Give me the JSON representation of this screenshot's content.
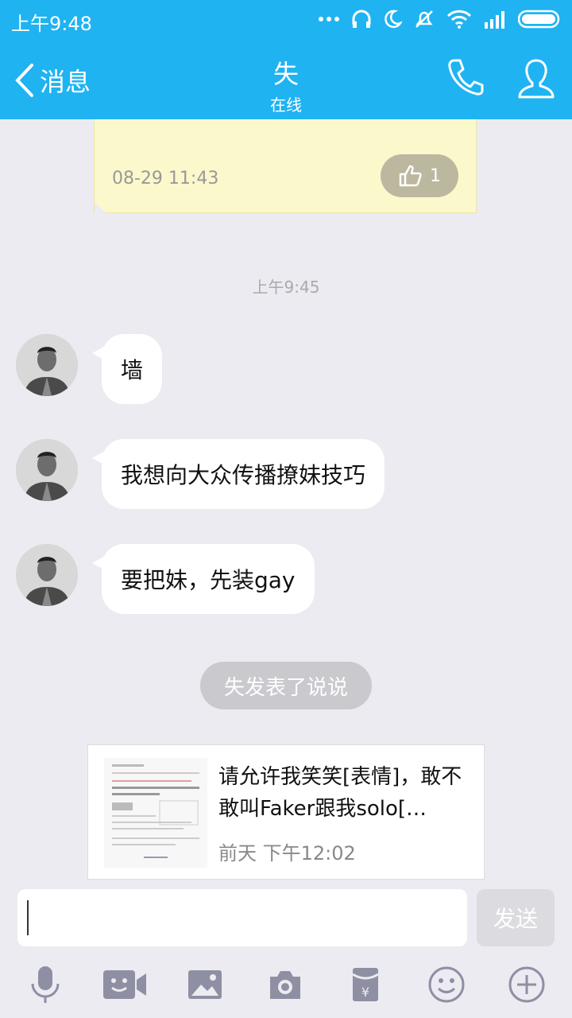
{
  "status_bar": {
    "time": "上午9:48"
  },
  "header": {
    "back_label": "消息",
    "title": "失",
    "subtitle": "在线"
  },
  "note_card": {
    "date": "08-29 11:43",
    "like_count": "1"
  },
  "timestamp": "上午9:45",
  "messages": [
    {
      "text": "墙"
    },
    {
      "text": "我想向大众传播撩妹技巧"
    },
    {
      "text": "要把妹，先装gay"
    }
  ],
  "system_notice": "失发表了说说",
  "post": {
    "text": "请允许我笑笑[表情]，敢不敢叫Faker跟我solo[…",
    "time": "前天 下午12:02"
  },
  "input": {
    "placeholder": "",
    "send_label": "发送"
  },
  "colors": {
    "brand": "#1fb3f2",
    "background": "#ebebf1",
    "note": "#fbf8cc"
  },
  "icons": [
    "back-chevron-icon",
    "phone-icon",
    "profile-icon",
    "microphone-icon",
    "video-icon",
    "image-icon",
    "camera-icon",
    "red-packet-icon",
    "emoji-icon",
    "plus-icon"
  ]
}
